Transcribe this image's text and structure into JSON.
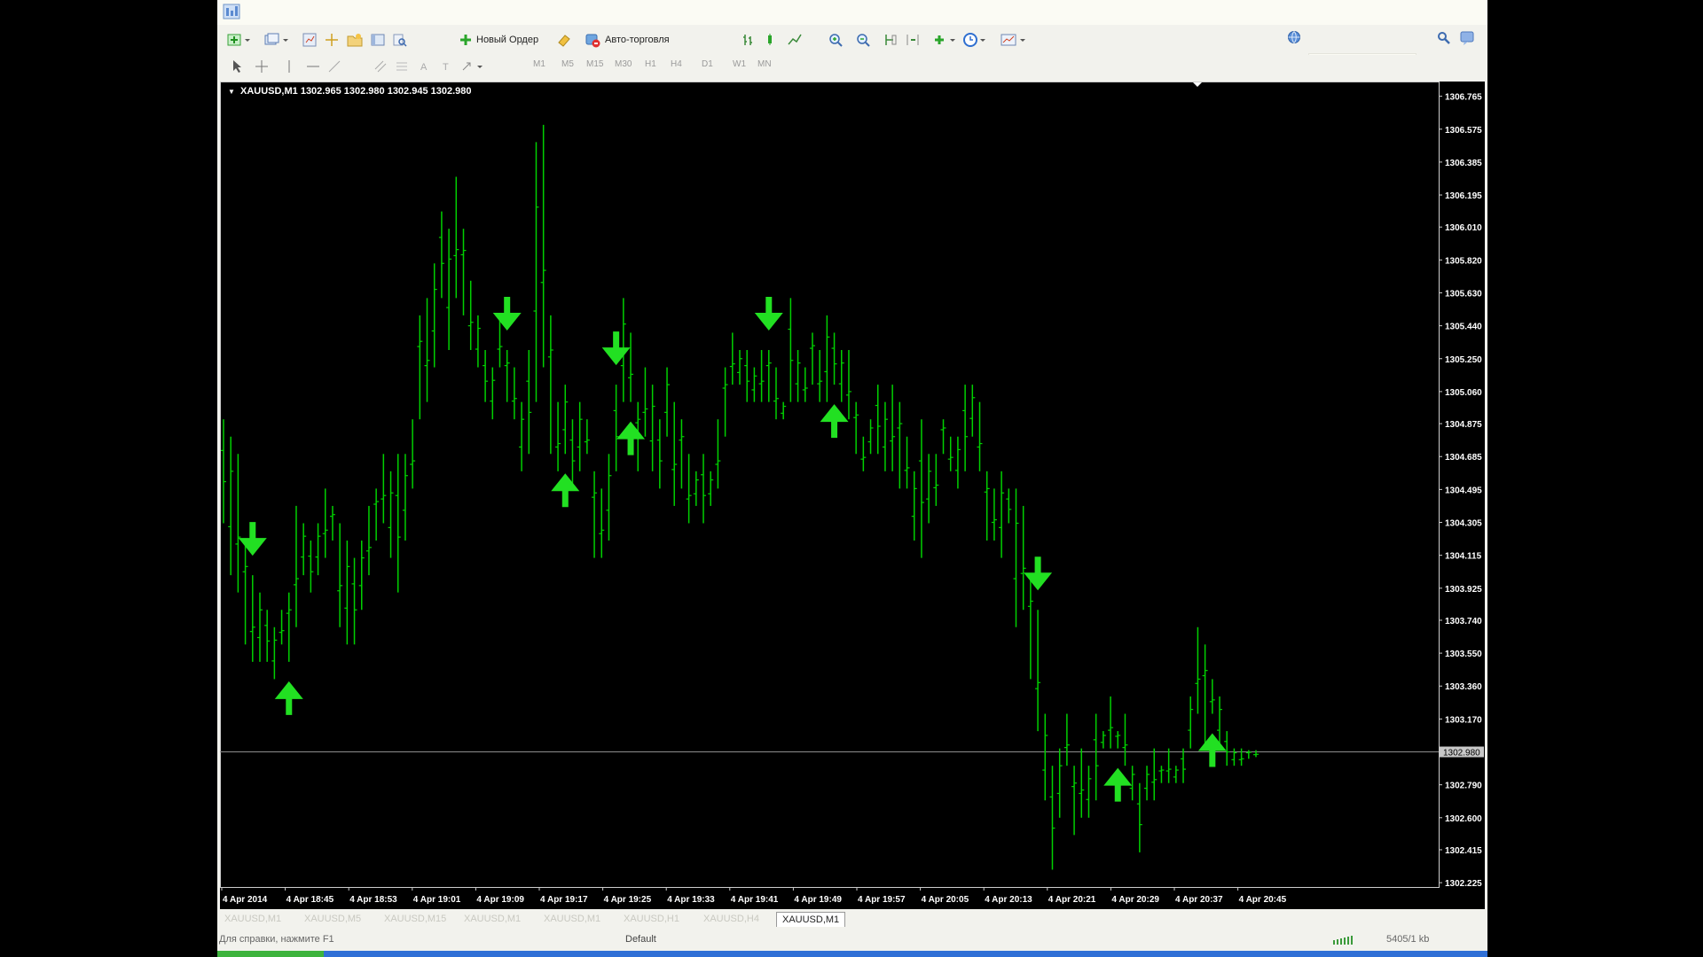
{
  "toolbar": {
    "new_order_label": "Новый Ордер",
    "auto_trading_label": "Авто-торговля",
    "timeframes": [
      "M1",
      "M5",
      "M15",
      "M30",
      "H1",
      "H4",
      "D1",
      "W1",
      "MN"
    ]
  },
  "chart": {
    "header": "XAUUSD,M1  1302.965 1302.980 1302.945 1302.980",
    "current_price_label": "1302.980",
    "colors": {
      "background": "#000000",
      "bars": "#00d000",
      "arrows": "#22e022",
      "axis_text": "#ffffff"
    }
  },
  "tabs": {
    "items": [
      "XAUUSD,M1",
      "XAUUSD,M5",
      "XAUUSD,M15",
      "XAUUSD,M1",
      "XAUUSD,M1",
      "XAUUSD,H1",
      "XAUUSD,H4",
      "XAUUSD,M1"
    ],
    "active_index": 7
  },
  "status": {
    "help": "Для справки, нажмите F1",
    "profile": "Default",
    "connection": "5405/1 kb"
  },
  "chart_data": {
    "type": "ohlc",
    "symbol": "XAUUSD",
    "timeframe": "M1",
    "ylim": [
      1302.2,
      1306.85
    ],
    "ticks_y": [
      "1306.765",
      "1306.575",
      "1306.385",
      "1306.195",
      "1306.010",
      "1305.820",
      "1305.630",
      "1305.440",
      "1305.250",
      "1305.060",
      "1304.875",
      "1304.685",
      "1304.495",
      "1304.305",
      "1304.115",
      "1303.925",
      "1303.740",
      "1303.550",
      "1303.360",
      "1303.170",
      "1302.980",
      "1302.790",
      "1302.600",
      "1302.415",
      "1302.225"
    ],
    "ticks_x": [
      "4 Apr 2014",
      "4 Apr 18:45",
      "4 Apr 18:53",
      "4 Apr 19:01",
      "4 Apr 19:09",
      "4 Apr 19:17",
      "4 Apr 19:25",
      "4 Apr 19:33",
      "4 Apr 19:41",
      "4 Apr 19:49",
      "4 Apr 19:57",
      "4 Apr 20:05",
      "4 Apr 20:13",
      "4 Apr 20:21",
      "4 Apr 20:29",
      "4 Apr 20:37",
      "4 Apr 20:45"
    ],
    "current_price": 1302.98,
    "bars": [
      [
        1304.9,
        1304.3
      ],
      [
        1304.8,
        1304.0
      ],
      [
        1304.7,
        1303.9
      ],
      [
        1304.2,
        1303.6
      ],
      [
        1304.0,
        1303.5
      ],
      [
        1303.9,
        1303.5
      ],
      [
        1303.8,
        1303.5
      ],
      [
        1303.7,
        1303.4
      ],
      [
        1303.8,
        1303.6
      ],
      [
        1303.9,
        1303.5
      ],
      [
        1304.4,
        1303.7
      ],
      [
        1304.3,
        1304.0
      ],
      [
        1304.2,
        1303.9
      ],
      [
        1304.3,
        1304.0
      ],
      [
        1304.5,
        1304.1
      ],
      [
        1304.4,
        1304.2
      ],
      [
        1304.3,
        1303.7
      ],
      [
        1304.2,
        1303.6
      ],
      [
        1304.1,
        1303.6
      ],
      [
        1304.2,
        1303.8
      ],
      [
        1304.4,
        1304.0
      ],
      [
        1304.5,
        1304.2
      ],
      [
        1304.7,
        1304.3
      ],
      [
        1304.6,
        1304.1
      ],
      [
        1304.7,
        1303.9
      ],
      [
        1304.7,
        1304.2
      ],
      [
        1304.9,
        1304.5
      ],
      [
        1305.5,
        1304.9
      ],
      [
        1305.6,
        1305.0
      ],
      [
        1305.8,
        1305.2
      ],
      [
        1306.1,
        1305.6
      ],
      [
        1306.0,
        1305.3
      ],
      [
        1306.3,
        1305.6
      ],
      [
        1306.0,
        1305.5
      ],
      [
        1305.7,
        1305.3
      ],
      [
        1305.5,
        1305.2
      ],
      [
        1305.3,
        1305.0
      ],
      [
        1305.2,
        1304.9
      ],
      [
        1305.5,
        1305.2
      ],
      [
        1305.3,
        1305.0
      ],
      [
        1305.2,
        1304.9
      ],
      [
        1305.0,
        1304.6
      ],
      [
        1305.3,
        1304.7
      ],
      [
        1306.5,
        1305.0
      ],
      [
        1306.6,
        1305.2
      ],
      [
        1305.5,
        1304.7
      ],
      [
        1305.0,
        1304.6
      ],
      [
        1305.1,
        1304.7
      ],
      [
        1304.9,
        1304.5
      ],
      [
        1305.0,
        1304.6
      ],
      [
        1304.9,
        1304.7
      ],
      [
        1304.6,
        1304.1
      ],
      [
        1304.5,
        1304.1
      ],
      [
        1304.7,
        1304.2
      ],
      [
        1305.1,
        1304.6
      ],
      [
        1305.6,
        1305.0
      ],
      [
        1305.4,
        1305.0
      ],
      [
        1305.0,
        1304.6
      ],
      [
        1305.2,
        1304.8
      ],
      [
        1305.1,
        1304.6
      ],
      [
        1304.9,
        1304.5
      ],
      [
        1305.2,
        1304.8
      ],
      [
        1305.0,
        1304.4
      ],
      [
        1304.9,
        1304.5
      ],
      [
        1304.7,
        1304.3
      ],
      [
        1304.6,
        1304.4
      ],
      [
        1304.7,
        1304.3
      ],
      [
        1304.6,
        1304.4
      ],
      [
        1304.9,
        1304.5
      ],
      [
        1305.2,
        1304.8
      ],
      [
        1305.4,
        1305.1
      ],
      [
        1305.3,
        1305.1
      ],
      [
        1305.3,
        1305.0
      ],
      [
        1305.2,
        1305.0
      ],
      [
        1305.3,
        1305.0
      ],
      [
        1305.3,
        1305.0
      ],
      [
        1305.2,
        1304.9
      ],
      [
        1305.0,
        1304.9
      ],
      [
        1305.6,
        1305.0
      ],
      [
        1305.3,
        1305.0
      ],
      [
        1305.2,
        1305.0
      ],
      [
        1305.4,
        1305.1
      ],
      [
        1305.3,
        1305.0
      ],
      [
        1305.5,
        1305.0
      ],
      [
        1305.4,
        1305.1
      ],
      [
        1305.3,
        1305.0
      ],
      [
        1305.3,
        1304.9
      ],
      [
        1305.0,
        1304.7
      ],
      [
        1304.8,
        1304.6
      ],
      [
        1304.9,
        1304.7
      ],
      [
        1305.1,
        1304.7
      ],
      [
        1305.0,
        1304.6
      ],
      [
        1305.1,
        1304.6
      ],
      [
        1305.0,
        1304.5
      ],
      [
        1304.8,
        1304.5
      ],
      [
        1304.6,
        1304.2
      ],
      [
        1304.9,
        1304.1
      ],
      [
        1304.7,
        1304.3
      ],
      [
        1304.7,
        1304.4
      ],
      [
        1304.9,
        1304.7
      ],
      [
        1304.8,
        1304.6
      ],
      [
        1304.8,
        1304.5
      ],
      [
        1305.1,
        1304.6
      ],
      [
        1305.1,
        1304.8
      ],
      [
        1305.0,
        1304.6
      ],
      [
        1304.6,
        1304.2
      ],
      [
        1304.5,
        1304.2
      ],
      [
        1304.6,
        1304.1
      ],
      [
        1304.5,
        1304.3
      ],
      [
        1304.5,
        1303.7
      ],
      [
        1304.4,
        1303.8
      ],
      [
        1304.0,
        1303.4
      ],
      [
        1303.8,
        1303.1
      ],
      [
        1303.2,
        1302.7
      ],
      [
        1302.9,
        1302.3
      ],
      [
        1303.0,
        1302.6
      ],
      [
        1303.2,
        1302.9
      ],
      [
        1302.9,
        1302.5
      ],
      [
        1303.0,
        1302.6
      ],
      [
        1302.9,
        1302.6
      ],
      [
        1303.2,
        1302.7
      ],
      [
        1303.1,
        1303.0
      ],
      [
        1303.3,
        1303.0
      ],
      [
        1303.1,
        1303.0
      ],
      [
        1303.2,
        1302.9
      ],
      [
        1302.9,
        1302.7
      ],
      [
        1302.8,
        1302.4
      ],
      [
        1302.9,
        1302.7
      ],
      [
        1303.0,
        1302.7
      ],
      [
        1302.9,
        1302.8
      ],
      [
        1303.0,
        1302.8
      ],
      [
        1302.9,
        1302.8
      ],
      [
        1303.0,
        1302.8
      ],
      [
        1303.3,
        1303.0
      ],
      [
        1303.7,
        1303.2
      ],
      [
        1303.6,
        1303.0
      ],
      [
        1303.4,
        1303.2
      ],
      [
        1303.3,
        1303.0
      ],
      [
        1303.1,
        1302.9
      ],
      [
        1303.0,
        1302.9
      ],
      [
        1303.0,
        1302.9
      ],
      [
        1302.99,
        1302.94
      ],
      [
        1302.99,
        1302.95
      ]
    ],
    "signals_down": [
      4,
      39,
      54,
      75,
      112
    ],
    "signals_up": [
      9,
      47,
      56,
      84,
      123,
      136
    ]
  }
}
